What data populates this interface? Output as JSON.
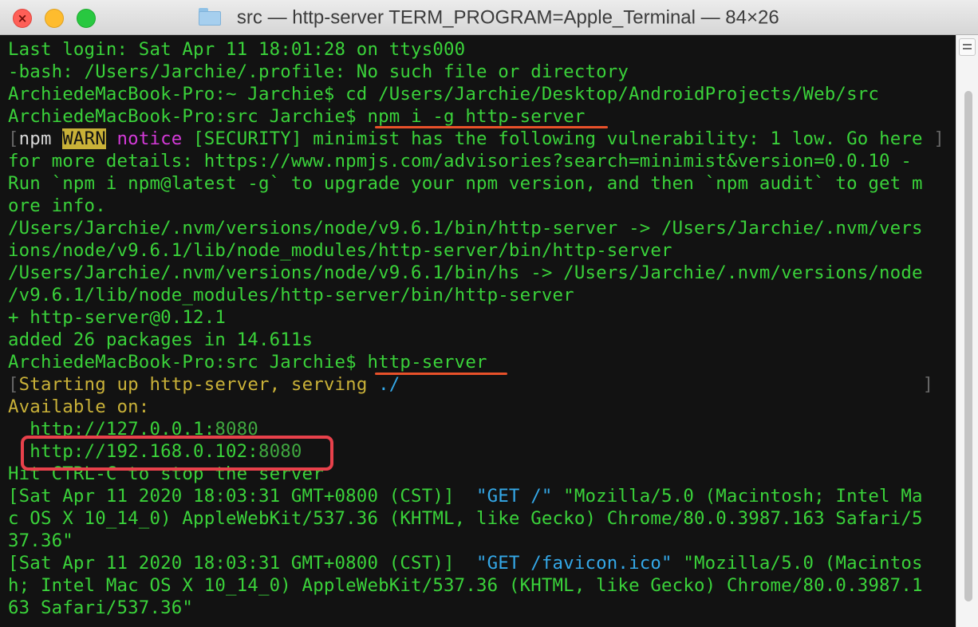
{
  "window": {
    "title": "src — http-server TERM_PROGRAM=Apple_Terminal — 84×26",
    "folder_icon": "folder-icon"
  },
  "terminal": {
    "lines": {
      "l1": "Last login: Sat Apr 11 18:01:28 on ttys000",
      "l2": "-bash: /Users/Jarchie/.profile: No such file or directory",
      "l3": "ArchiedeMacBook-Pro:~ Jarchie$ cd /Users/Jarchie/Desktop/AndroidProjects/Web/src",
      "l4_prompt": "ArchiedeMacBook-Pro:src Jarchie$ ",
      "l4_cmd": "npm i -g http-server",
      "l5_open": "[",
      "l5_npm": "npm",
      "l5_warn": "WARN",
      "l5_notice": "notice",
      "l5_msg": "[SECURITY] minimist has the following vulnerability: 1 low. Go here",
      "l5_close": "]",
      "l6": "for more details: https://www.npmjs.com/advisories?search=minimist&version=0.0.10 -",
      "l7": "Run `npm i npm@latest -g` to upgrade your npm version, and then `npm audit` to get m",
      "l8": "ore info.",
      "l9": "/Users/Jarchie/.nvm/versions/node/v9.6.1/bin/http-server -> /Users/Jarchie/.nvm/vers",
      "l10": "ions/node/v9.6.1/lib/node_modules/http-server/bin/http-server",
      "l11": "/Users/Jarchie/.nvm/versions/node/v9.6.1/bin/hs -> /Users/Jarchie/.nvm/versions/node",
      "l12": "/v9.6.1/lib/node_modules/http-server/bin/http-server",
      "l13": "+ http-server@0.12.1",
      "l14": "added 26 packages in 14.611s",
      "l15_prompt": "ArchiedeMacBook-Pro:src Jarchie$ ",
      "l15_cmd": "http-server",
      "l16_open": "[",
      "l16_text": "Starting up http-server, serving ",
      "l16_path": "./",
      "l16_close": "]",
      "l17": "Available on:",
      "l18_url": "  http://127.0.0.1:",
      "l18_port": "8080",
      "l19_url": "  http://192.168.0.102:",
      "l19_port": "8080",
      "l20": "Hit CTRL-C to stop the server",
      "l21_ts": "[Sat Apr 11 2020 18:03:31 GMT+0800 (CST)]  ",
      "l21_req": "\"GET /\"",
      "l21_ua": " \"Mozilla/5.0 (Macintosh; Intel Ma",
      "l22": "c OS X 10_14_0) AppleWebKit/537.36 (KHTML, like Gecko) Chrome/80.0.3987.163 Safari/5",
      "l23": "37.36\"",
      "l24_ts": "[Sat Apr 11 2020 18:03:31 GMT+0800 (CST)]  ",
      "l24_req": "\"GET /favicon.ico\"",
      "l24_ua": " \"Mozilla/5.0 (Macintos",
      "l25": "h; Intel Mac OS X 10_14_0) AppleWebKit/537.36 (KHTML, like Gecko) Chrome/80.0.3987.1",
      "l26": "63 Safari/537.36\""
    }
  },
  "annotations": {
    "underline_color": "#e8512a",
    "box_color": "#e8414b"
  }
}
